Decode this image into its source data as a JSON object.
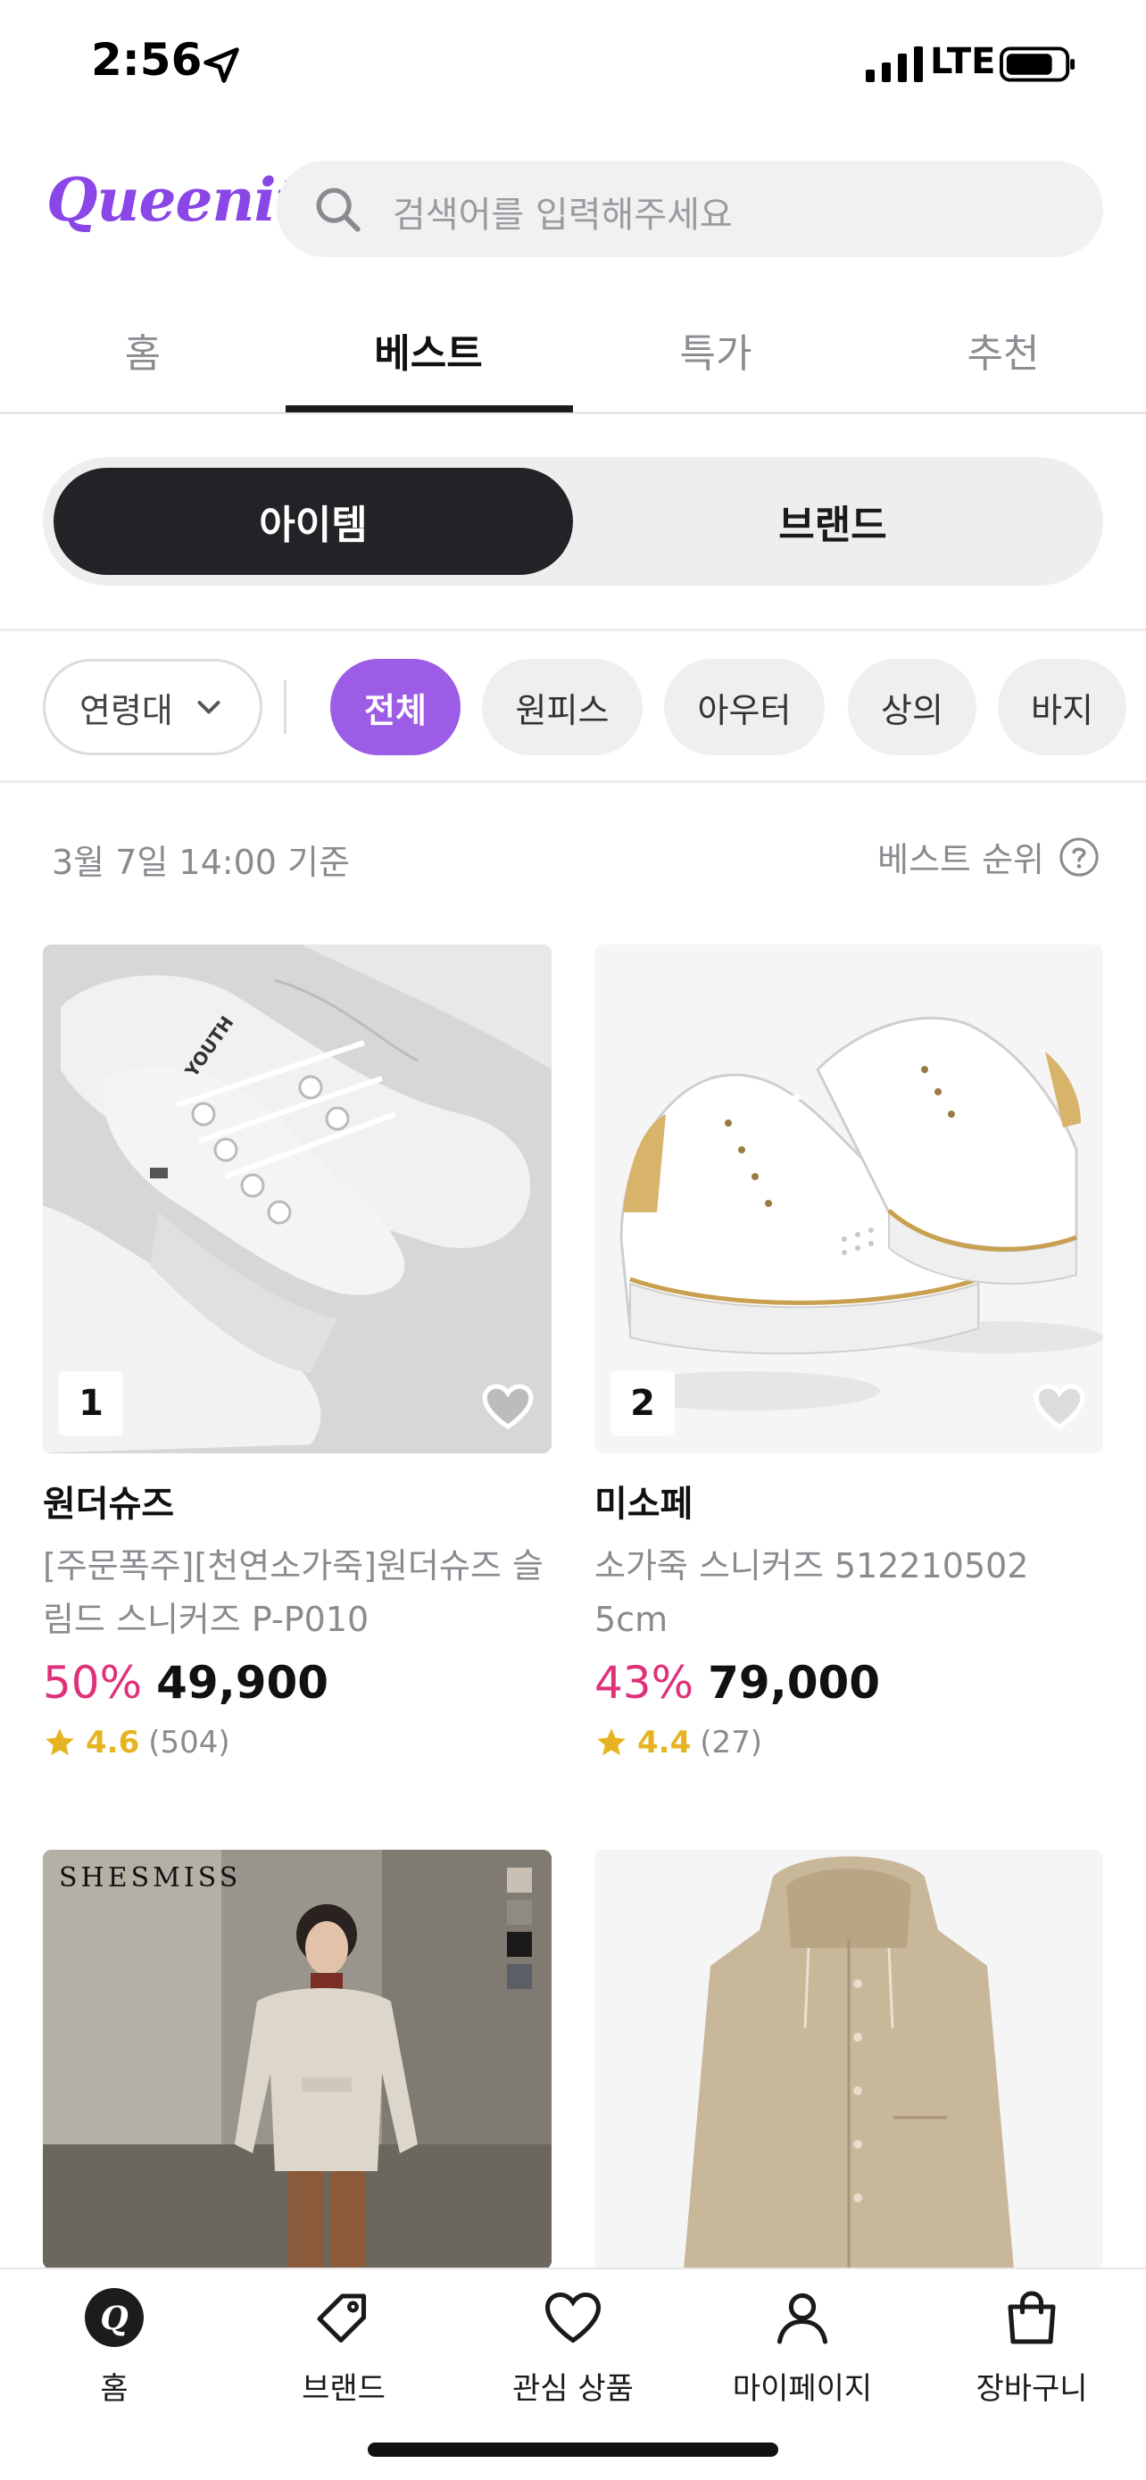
{
  "status_bar": {
    "time": "2:56",
    "network": "LTE"
  },
  "header": {
    "logo": "Queenit",
    "search_placeholder": "검색어를 입력해주세요"
  },
  "main_tabs": [
    {
      "label": "홈",
      "active": false
    },
    {
      "label": "베스트",
      "active": true
    },
    {
      "label": "특가",
      "active": false
    },
    {
      "label": "추천",
      "active": false
    }
  ],
  "segment": {
    "items": [
      "아이템",
      "브랜드"
    ],
    "active_index": 0
  },
  "filters": {
    "age_select": "연령대",
    "chips": [
      "전체",
      "원피스",
      "아우터",
      "상의",
      "바지"
    ],
    "active_chip": "전체"
  },
  "info": {
    "updated": "3월 7일 14:00 기준",
    "rank_label": "베스트 순위"
  },
  "products": [
    {
      "rank": "1",
      "brand": "원더슈즈",
      "name": "[주문폭주][천연소가죽]원더슈즈 슬림드 스니커즈 P-P010",
      "discount": "50%",
      "price": "49,900",
      "rating": "4.6",
      "reviews": "(504)",
      "liked": false
    },
    {
      "rank": "2",
      "brand": "미소페",
      "name": "소가죽 스니커즈 512210502 5cm",
      "discount": "43%",
      "price": "79,000",
      "rating": "4.4",
      "reviews": "(27)",
      "liked": false
    },
    {
      "brand_overlay": "SHESMISS"
    }
  ],
  "bottom_nav": [
    {
      "label": "홈",
      "icon": "queenit-home-icon"
    },
    {
      "label": "브랜드",
      "icon": "tag-icon"
    },
    {
      "label": "관심 상품",
      "icon": "heart-icon"
    },
    {
      "label": "마이페이지",
      "icon": "person-icon"
    },
    {
      "label": "장바구니",
      "icon": "shopping-bag-icon"
    }
  ],
  "colors": {
    "brand": "#8a46e6",
    "active_chip": "#9c5ce6",
    "discount": "#e0307a",
    "star": "#e6b422"
  }
}
